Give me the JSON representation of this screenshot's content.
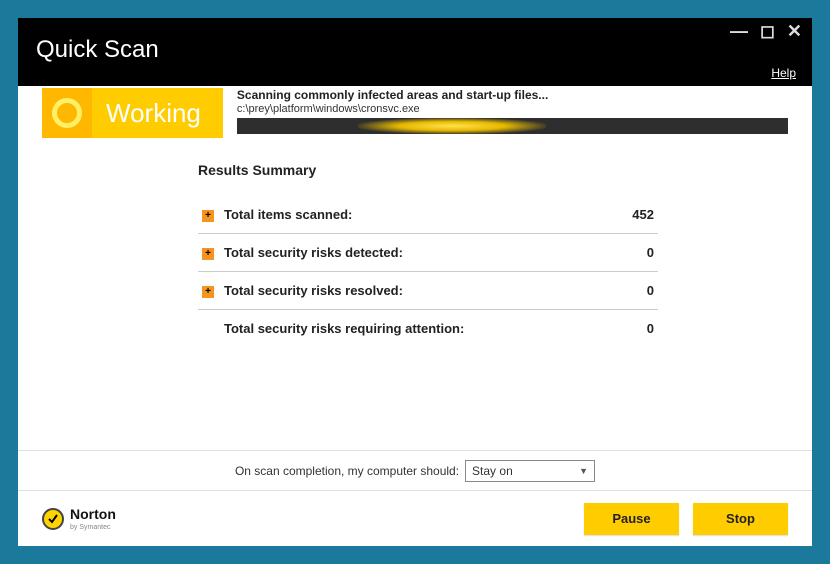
{
  "window": {
    "title": "Quick Scan",
    "help": "Help"
  },
  "status": {
    "badge": "Working",
    "message": "Scanning commonly infected areas and start-up files...",
    "currentFile": "c:\\prey\\platform\\windows\\cronsvc.exe"
  },
  "results": {
    "heading": "Results Summary",
    "rows": [
      {
        "label": "Total items scanned:",
        "value": "452",
        "expandable": true
      },
      {
        "label": "Total security risks detected:",
        "value": "0",
        "expandable": true
      },
      {
        "label": "Total security risks resolved:",
        "value": "0",
        "expandable": true
      },
      {
        "label": "Total security risks requiring attention:",
        "value": "0",
        "expandable": false
      }
    ]
  },
  "completion": {
    "prompt": "On scan completion, my computer should:",
    "selected": "Stay on"
  },
  "branding": {
    "name": "Norton",
    "byline": "by Symantec"
  },
  "actions": {
    "pause": "Pause",
    "stop": "Stop"
  }
}
